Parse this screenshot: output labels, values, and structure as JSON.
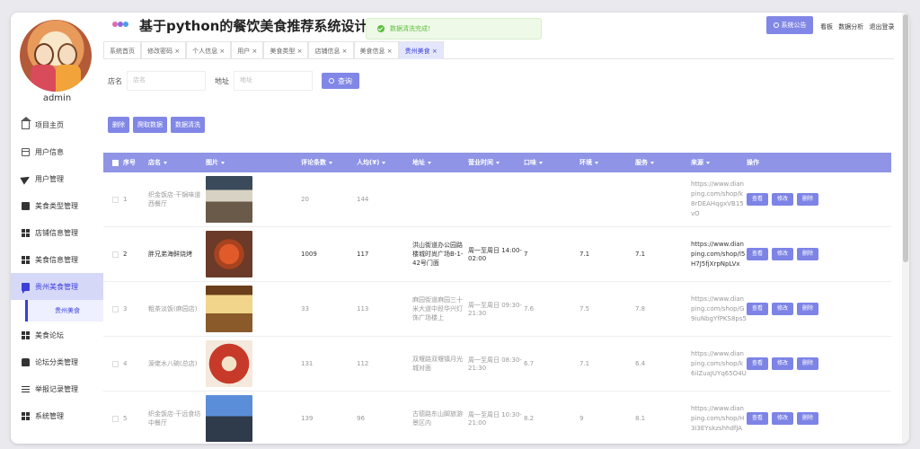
{
  "app": {
    "title": "基于python的餐饮美食推荐系统设计与"
  },
  "toast": {
    "text": "数据清洗完成!"
  },
  "header": {
    "notice_label": "系统公告",
    "links": [
      "看板",
      "数据分析",
      "退出登录"
    ]
  },
  "user": {
    "name": "admin"
  },
  "sidebar": {
    "items": [
      {
        "label": "项目主页",
        "icon": "home-icon"
      },
      {
        "label": "用户信息",
        "icon": "card-icon"
      },
      {
        "label": "用户管理",
        "icon": "send-icon"
      },
      {
        "label": "美食类型管理",
        "icon": "edit-icon"
      },
      {
        "label": "店铺信息管理",
        "icon": "grid-icon"
      },
      {
        "label": "美食信息管理",
        "icon": "grid-icon"
      },
      {
        "label": "贵州美食管理",
        "icon": "chat-icon"
      },
      {
        "label": "美食论坛",
        "icon": "grid-icon"
      },
      {
        "label": "论坛分类管理",
        "icon": "thumb-icon"
      },
      {
        "label": "举报记录管理",
        "icon": "lines-icon"
      },
      {
        "label": "系统管理",
        "icon": "grid-icon"
      }
    ],
    "sub_item": "贵州美食"
  },
  "tabs": [
    "系统首页",
    "修改密码",
    "个人信息",
    "用户",
    "美食类型",
    "店铺信息",
    "美食信息",
    "贵州美食"
  ],
  "search": {
    "name_label": "店名",
    "name_placeholder": "店名",
    "addr_label": "地址",
    "addr_placeholder": "地址",
    "button": "查询"
  },
  "actions": [
    "删除",
    "爬取数据",
    "数据清洗"
  ],
  "table": {
    "headers": [
      "序号",
      "店名",
      "图片",
      "评论条数",
      "人均(¥)",
      "地址",
      "营业时间",
      "口味",
      "环境",
      "服务",
      "来源",
      "操作"
    ],
    "rows": [
      {
        "no": "1",
        "name": "织金饭店·干锅味道西餐厅",
        "pic": "p1",
        "comments": "20",
        "avg": "144",
        "addr": "",
        "hours": "",
        "taste": "",
        "env": "",
        "service": "",
        "source": "https://www.dianping.com/shop/k8rDEAHqgxVB15vO"
      },
      {
        "no": "2",
        "name": "胖兄弟海鲜烧烤",
        "pic": "p2",
        "comments": "1009",
        "avg": "117",
        "addr": "洪山街道办公园路楼城时尚广场B-1-42号门面",
        "hours": "周一至周日 14:00-02:00",
        "taste": "7",
        "env": "7.1",
        "service": "7.1",
        "source": "https://www.dianping.com/shop/l5H7J5fjXrpNpLVx"
      },
      {
        "no": "3",
        "name": "粗茶淡饭(麻园店)",
        "pic": "p3",
        "comments": "33",
        "avg": "113",
        "addr": "麻园街道麻园三十米大道中段华兴灯饰广场楼上",
        "hours": "周一至周日 09:30-21:30",
        "taste": "7.6",
        "env": "7.5",
        "service": "7.8",
        "source": "https://www.dianping.com/shop/G9iuNbgYfPKS8ps5"
      },
      {
        "no": "4",
        "name": "源佬水八碗(总店)",
        "pic": "p4",
        "comments": "131",
        "avg": "112",
        "addr": "双堰路双堰镇月光城对面",
        "hours": "周一至周日 08:30-21:30",
        "taste": "6.7",
        "env": "7.1",
        "service": "6.4",
        "source": "https://www.dianping.com/shop/k6ilZuaJUYq65O4U"
      },
      {
        "no": "5",
        "name": "织金饭店·干远食坊中餐厅",
        "pic": "p5",
        "comments": "139",
        "avg": "96",
        "addr": "古德路东山脚旅游景区内",
        "hours": "周一至周日 10:30-21:00",
        "taste": "8.2",
        "env": "9",
        "service": "8.1",
        "source": "https://www.dianping.com/shop/H3i3EYskzshhdfJA"
      }
    ],
    "op_labels": [
      "查看",
      "修改",
      "删除"
    ]
  },
  "colors": {
    "accent": "#8187e6",
    "active_bg": "#d6d8f8",
    "toast_green": "#5bbf3a"
  }
}
